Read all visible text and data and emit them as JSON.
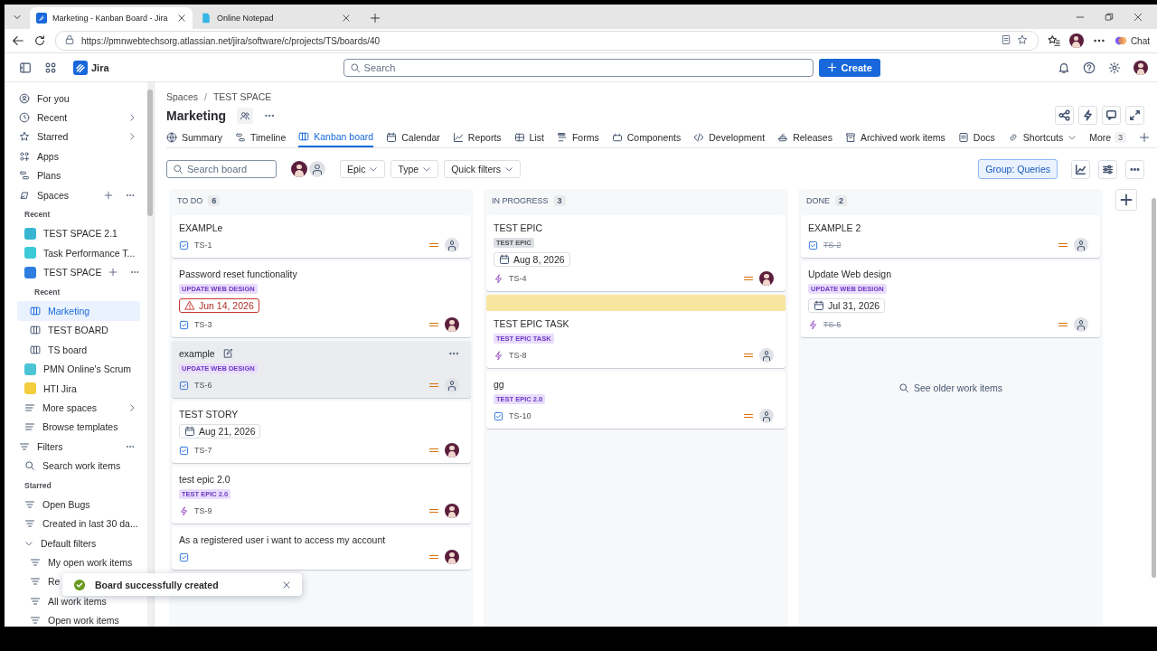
{
  "browser": {
    "tabs": [
      {
        "title": "Marketing - Kanban Board - Jira",
        "selected": true
      },
      {
        "title": "Online Notepad",
        "selected": false
      }
    ],
    "url": "https://pmnwebtechsorg.atlassian.net/jira/software/c/projects/TS/boards/40",
    "chat_label": "Chat"
  },
  "app": {
    "name": "Jira",
    "search_placeholder": "Search",
    "create_label": "Create"
  },
  "sidebar": {
    "nav": [
      {
        "label": "For you",
        "chevron": false
      },
      {
        "label": "Recent",
        "chevron": true
      },
      {
        "label": "Starred",
        "chevron": true
      },
      {
        "label": "Apps",
        "chevron": false
      },
      {
        "label": "Plans",
        "chevron": false
      }
    ],
    "spaces_label": "Spaces",
    "recent_label": "Recent",
    "spaces": [
      {
        "name": "TEST SPACE 2.1",
        "color": "#38b6d1"
      },
      {
        "name": "Task Performance T...",
        "color": "#3ccbd6"
      },
      {
        "name": "TEST SPACE",
        "color": "#2d7ee0",
        "recent_label": "Recent",
        "children": [
          {
            "label": "Marketing",
            "selected": true
          },
          {
            "label": "TEST BOARD",
            "selected": false
          },
          {
            "label": "TS board",
            "selected": false
          }
        ]
      },
      {
        "name": "PMN Online's Scrum",
        "color": "#4cc4d4"
      },
      {
        "name": "HTI Jira",
        "color": "#f2cd3c"
      }
    ],
    "links": [
      {
        "label": "More spaces",
        "chevron": true
      },
      {
        "label": "Browse templates",
        "chevron": false
      }
    ],
    "filters_label": "Filters",
    "search_label": "Search work items",
    "starred_label": "Starred",
    "filters": [
      {
        "label": "Open Bugs"
      },
      {
        "label": "Created in last 30 da..."
      },
      {
        "label": "Default filters",
        "children": [
          {
            "label": "My open work items"
          },
          {
            "label": "Re"
          },
          {
            "label": "All work items"
          },
          {
            "label": "Open work items"
          }
        ]
      }
    ]
  },
  "breadcrumbs": [
    "Spaces",
    "TEST SPACE"
  ],
  "breadcrumb_separator": "/",
  "title": "Marketing",
  "tabs": [
    {
      "label": "Summary",
      "selected": false
    },
    {
      "label": "Timeline",
      "selected": false
    },
    {
      "label": "Kanban board",
      "selected": true
    },
    {
      "label": "Calendar",
      "selected": false
    },
    {
      "label": "Reports",
      "selected": false
    },
    {
      "label": "List",
      "selected": false
    },
    {
      "label": "Forms",
      "selected": false
    },
    {
      "label": "Components",
      "selected": false
    },
    {
      "label": "Development",
      "selected": false
    },
    {
      "label": "Releases",
      "selected": false
    },
    {
      "label": "Archived work items",
      "selected": false
    },
    {
      "label": "Docs",
      "selected": false
    },
    {
      "label": "Shortcuts",
      "selected": false
    }
  ],
  "more_tab": {
    "label": "More",
    "count": "3"
  },
  "toolbar": {
    "search_placeholder": "Search board",
    "filters": [
      "Epic",
      "Type",
      "Quick filters"
    ],
    "group_label": "Group: Queries"
  },
  "columns": [
    {
      "name": "TO DO",
      "count": "6",
      "cards": [
        {
          "title": "EXAMPLe",
          "key": "TS-1",
          "kind": "task",
          "done": false,
          "assigned": false,
          "hovered": false,
          "flagged": false
        },
        {
          "title": "Password reset functionality",
          "epic": {
            "label": "UPDATE WEB DESIGN",
            "color": "#e9ddfc"
          },
          "date": {
            "text": "Jun 14, 2026",
            "overdue": true
          },
          "key": "TS-3",
          "kind": "task",
          "done": false,
          "assigned": true,
          "hovered": false,
          "flagged": false
        },
        {
          "title": "example",
          "epic": {
            "label": "UPDATE WEB DESIGN",
            "color": "#e9ddfc"
          },
          "key": "TS-6",
          "kind": "task",
          "done": false,
          "assigned": false,
          "hovered": true,
          "flagged": false
        },
        {
          "title": "TEST STORY",
          "date": {
            "text": "Aug 21, 2026",
            "overdue": false
          },
          "key": "TS-7",
          "kind": "task",
          "done": false,
          "assigned": true,
          "hovered": false,
          "flagged": false
        },
        {
          "title": "test epic 2.0",
          "epic": {
            "label": "TEST EPIC 2.0",
            "color": "#e9ddfc"
          },
          "key": "TS-9",
          "kind": "epic",
          "done": false,
          "assigned": true,
          "hovered": false,
          "flagged": false
        },
        {
          "title": "As a registered user i want to access my account",
          "kind": "task",
          "done": false,
          "assigned": true,
          "hovered": false,
          "flagged": false
        }
      ]
    },
    {
      "name": "IN PROGRESS",
      "count": "3",
      "cards": [
        {
          "title": "TEST EPIC",
          "epic": {
            "label": "TEST EPIC",
            "color": "#dcdfe4"
          },
          "date": {
            "text": "Aug 8, 2026",
            "overdue": false
          },
          "key": "TS-4",
          "kind": "epic",
          "done": false,
          "assigned": true,
          "hovered": false,
          "flagged": false
        },
        {
          "title": "TEST EPIC TASK",
          "epic": {
            "label": "TEST EPIC TASK",
            "color": "#e9ddfc"
          },
          "key": "TS-8",
          "kind": "epic",
          "done": false,
          "assigned": false,
          "hovered": false,
          "flagged": true
        },
        {
          "title": "gg",
          "epic": {
            "label": "TEST EPIC 2.0",
            "color": "#e9ddfc"
          },
          "key": "TS-10",
          "kind": "task",
          "done": false,
          "assigned": false,
          "hovered": false,
          "flagged": false
        }
      ]
    },
    {
      "name": "DONE",
      "count": "2",
      "cards": [
        {
          "title": "EXAMPLE 2",
          "key": "TS-2",
          "kind": "task",
          "done": true,
          "assigned": false,
          "hovered": false,
          "flagged": false
        },
        {
          "title": "Update Web design",
          "epic": {
            "label": "UPDATE WEB DESIGN",
            "color": "#e9ddfc"
          },
          "date": {
            "text": "Jul 31, 2026",
            "overdue": false
          },
          "key": "TS-5",
          "kind": "epic",
          "done": true,
          "assigned": false,
          "hovered": false,
          "flagged": false
        }
      ],
      "footer": "See older work items"
    }
  ],
  "toast": {
    "message": "Board successfully created"
  }
}
